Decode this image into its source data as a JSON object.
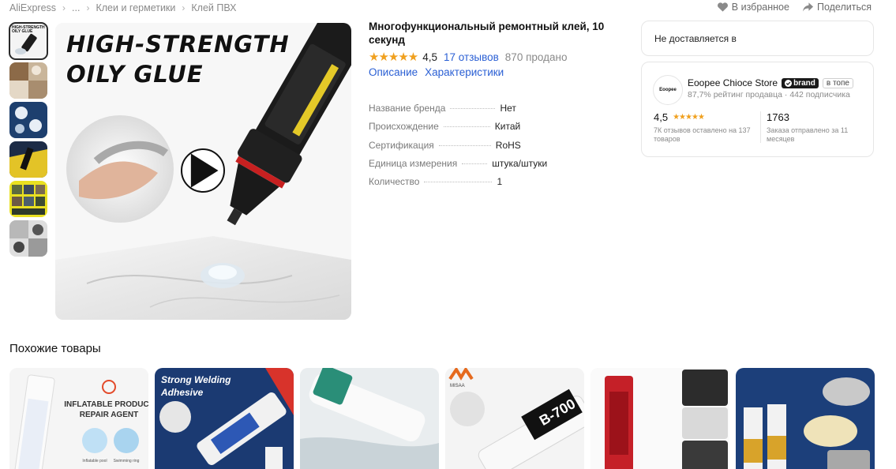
{
  "breadcrumbs": [
    "AliExpress",
    "...",
    "Клеи и герметики",
    "Клей ПВХ"
  ],
  "top_actions": {
    "favorite": "В избранное",
    "share": "Поделиться"
  },
  "thumbnails": [
    {
      "name": "thumb-1",
      "active": true
    },
    {
      "name": "thumb-2"
    },
    {
      "name": "thumb-3"
    },
    {
      "name": "thumb-4"
    },
    {
      "name": "thumb-5"
    },
    {
      "name": "thumb-6"
    }
  ],
  "main_image": {
    "headline_line1": "HIGH-STRENGTH",
    "headline_line2": "OILY GLUE",
    "thumb_line1": "HIGH-STRENGTH",
    "thumb_line2": "OILY GLUE"
  },
  "product": {
    "title": "Многофункциональный ремонтный клей, 10 секунд",
    "rating": 4.5,
    "rating_label": "4,5",
    "reviews": "17 отзывов",
    "sold": "870 продано",
    "tabs": [
      "Описание",
      "Характеристики"
    ]
  },
  "specs": [
    {
      "key": "Название бренда",
      "value": "Нет"
    },
    {
      "key": "Происхождение",
      "value": "Китай"
    },
    {
      "key": "Сертификация",
      "value": "RoHS"
    },
    {
      "key": "Единица измерения",
      "value": "штука/штуки"
    },
    {
      "key": "Количество",
      "value": "1"
    }
  ],
  "shipping": {
    "text": "Не доставляется в"
  },
  "store": {
    "logo_text": "Eoopee",
    "name": "Eoopee Chioce Store",
    "badge_brand": "brand",
    "badge_top": "в топе",
    "meta": "87,7% рейтинг продавца · 442 подписчика",
    "rating_value": "4,5",
    "rating_caption": "7К отзывов оставлено на 137 товаров",
    "orders_value": "1763",
    "orders_caption": "Заказа отправлено за 11 месяцев"
  },
  "similar": {
    "title": "Похожие товары",
    "cards": [
      {
        "text1": "INFLATABLE PRODUCT",
        "text2": "REPAIR AGENT",
        "cap1": "Inflatable pool",
        "cap2": "Swimming ring"
      },
      {
        "text1": "Strong Welding",
        "text2": "Adhesive"
      },
      {
        "text1": "",
        "text2": ""
      },
      {
        "text1": "MISAA",
        "text2": "B-700"
      },
      {
        "text1": "",
        "text2": ""
      },
      {
        "text1": "",
        "text2": ""
      }
    ]
  },
  "colors": {
    "link": "#2a5fd4",
    "star": "#f0a01e",
    "border": "#e6e6e6"
  }
}
